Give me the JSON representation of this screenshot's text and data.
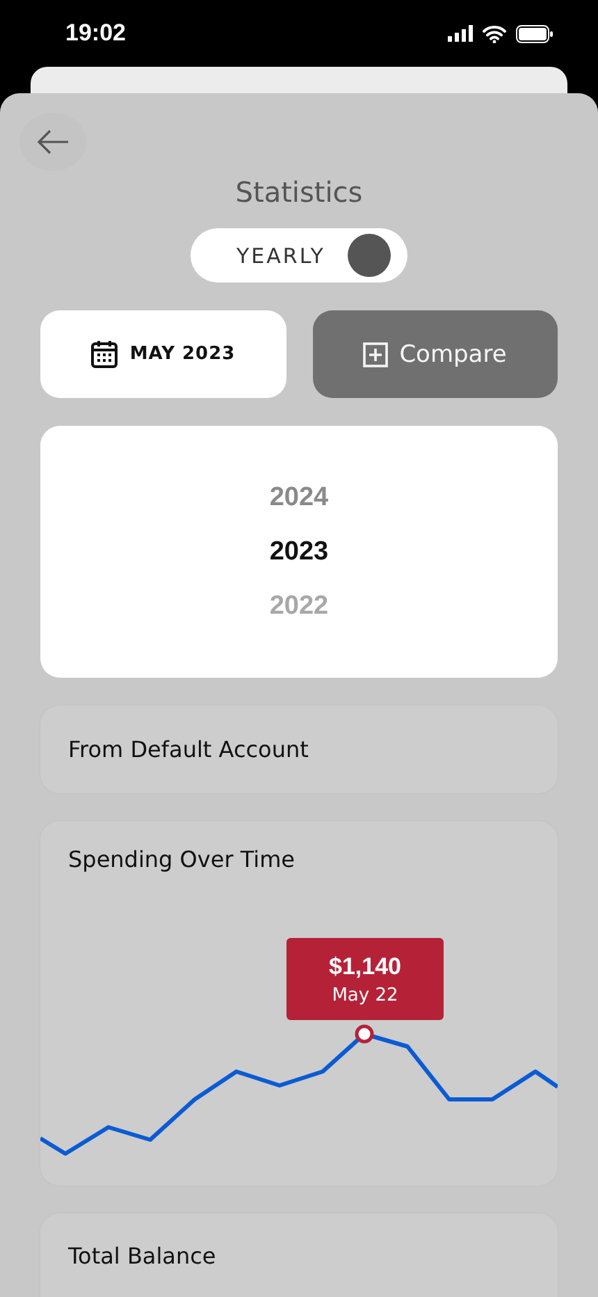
{
  "status_bar": {
    "time": "19:02"
  },
  "header": {
    "title": "Statistics"
  },
  "period_toggle": {
    "label": "YEARLY",
    "on": true
  },
  "actions": [
    {
      "kind": "date",
      "label": "MAY 2023"
    },
    {
      "kind": "compare",
      "label": "Compare"
    }
  ],
  "year_picker": [
    {
      "label": "2024",
      "selected": false
    },
    {
      "label": "2023",
      "selected": true
    },
    {
      "label": "2022",
      "selected": false
    }
  ],
  "account": {
    "label": "From Default Account"
  },
  "spending_chart": {
    "title": "Spending Over Time",
    "tooltip": {
      "value": "$1,140",
      "date": "May 22"
    }
  },
  "balance": {
    "title": "Total Balance"
  }
}
